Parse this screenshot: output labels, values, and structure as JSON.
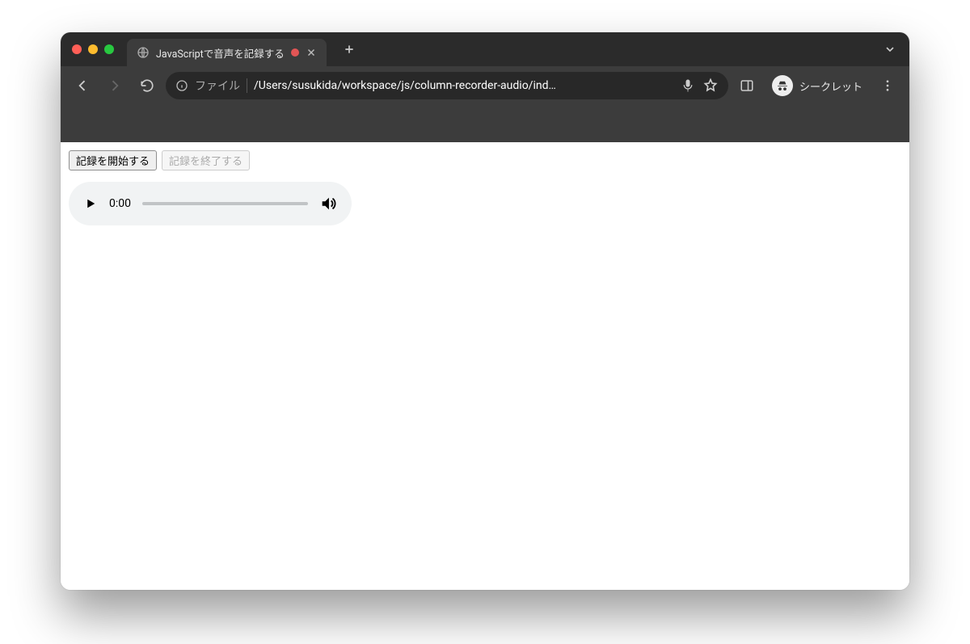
{
  "tab": {
    "title": "JavaScriptで音声を記録する"
  },
  "omnibox": {
    "scheme_label": "ファイル",
    "url": "/Users/susukida/workspace/js/column-recorder-audio/ind…"
  },
  "incognito": {
    "label": "シークレット"
  },
  "page": {
    "start_label": "記録を開始する",
    "stop_label": "記録を終了する",
    "audio": {
      "time": "0:00"
    }
  }
}
